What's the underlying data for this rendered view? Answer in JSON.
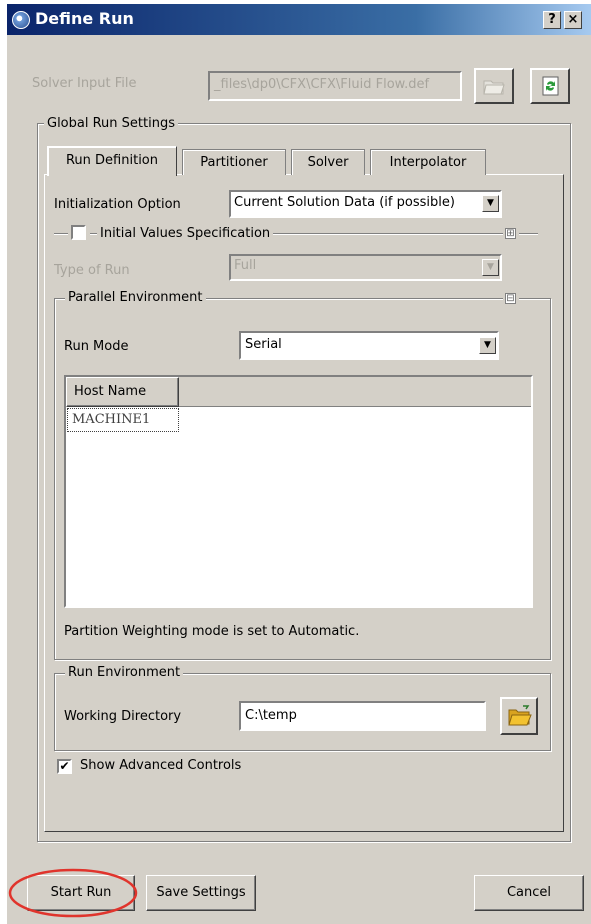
{
  "window": {
    "title": "Define Run",
    "help_label": "?",
    "close_label": "×"
  },
  "solver_input": {
    "label": "Solver Input File",
    "value": "_files\\dp0\\CFX\\CFX\\Fluid Flow.def"
  },
  "global_run_settings": {
    "legend": "Global Run Settings"
  },
  "tabs": [
    {
      "label": "Run Definition",
      "active": true
    },
    {
      "label": "Partitioner"
    },
    {
      "label": "Solver"
    },
    {
      "label": "Interpolator"
    }
  ],
  "run_definition": {
    "initialization": {
      "label": "Initialization Option",
      "value": "Current Solution Data (if possible)"
    },
    "initial_values": {
      "label": "Initial Values Specification",
      "checked": false,
      "toggle": "⊞"
    },
    "type_of_run": {
      "label": "Type of Run",
      "value": "Full"
    },
    "parallel_env": {
      "legend": "Parallel Environment",
      "toggle": "⊟",
      "run_mode": {
        "label": "Run Mode",
        "value": "Serial"
      },
      "host_table": {
        "header": "Host Name",
        "rows": [
          "MACHINE1"
        ]
      },
      "partition_note": "Partition Weighting mode is set to Automatic."
    },
    "run_environment": {
      "legend": "Run Environment",
      "working_dir": {
        "label": "Working Directory",
        "value": "C:\\temp"
      }
    },
    "show_advanced": {
      "label": "Show Advanced Controls",
      "checked": true
    }
  },
  "buttons": {
    "start": "Start Run",
    "save": "Save Settings",
    "cancel": "Cancel"
  },
  "colors": {
    "dialog_bg": "#d4d0c8",
    "title_start": "#0a246a",
    "title_end": "#a6caf0",
    "highlight_ellipse": "#e0342c",
    "folder": "#f2c230"
  }
}
